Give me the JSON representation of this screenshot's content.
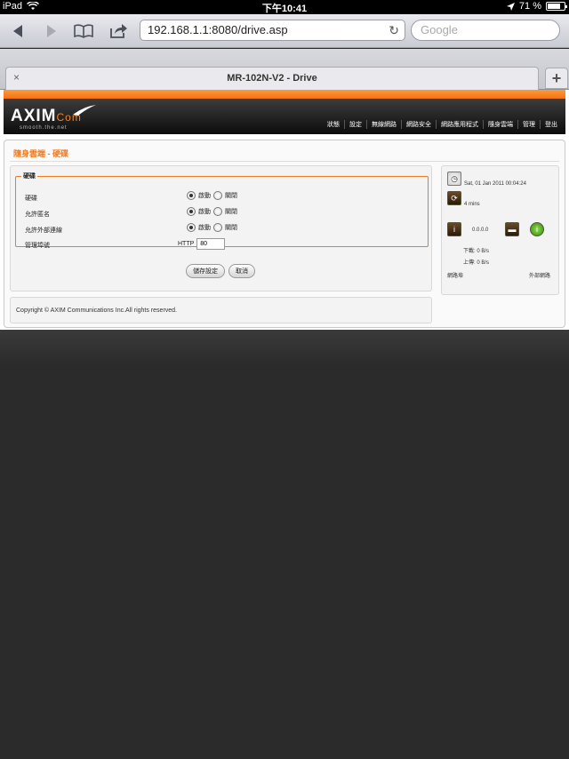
{
  "status_bar": {
    "device": "iPad",
    "time": "下午10:41",
    "battery": "71 %",
    "battery_level": 0.71
  },
  "browser": {
    "url": "192.168.1.1:8080/drive.asp",
    "search_placeholder": "Google",
    "tab_title": "MR-102N-V2 - Drive",
    "tab_close": "×",
    "new_tab": "+"
  },
  "header": {
    "logo_main": "AXIM",
    "logo_com": "Com",
    "logo_tagline": "smooth.the.net",
    "nav": [
      "狀態",
      "設定",
      "無線網路",
      "網路安全",
      "網路應用程式",
      "隨身雲端",
      "管理",
      "登出"
    ]
  },
  "breadcrumb": "隨身雲端 - 硬碟",
  "form": {
    "legend": "硬碟",
    "rows": [
      {
        "label": "硬碟",
        "enable": "啟動",
        "disable": "關閉"
      },
      {
        "label": "允許匿名",
        "enable": "啟動",
        "disable": "關閉"
      },
      {
        "label": "允許外部連線",
        "enable": "啟動",
        "disable": "關閉"
      }
    ],
    "port_label": "管理埠號",
    "port_protocol": "HTTP",
    "port_value": "80",
    "save_label": "儲存設定",
    "cancel_label": "取消"
  },
  "footer": "Copyright © AXIM Communications Inc.All rights reserved.",
  "sidebar": {
    "datetime": "Sat, 01 Jan 2011 00:04:24",
    "uptime": "4 mins",
    "ip": "0.0.0.0",
    "download": "下載: 0 B/s",
    "upload": "上傳: 0 B/s",
    "lan_label": "網路埠",
    "wan_label": "外部網路"
  }
}
